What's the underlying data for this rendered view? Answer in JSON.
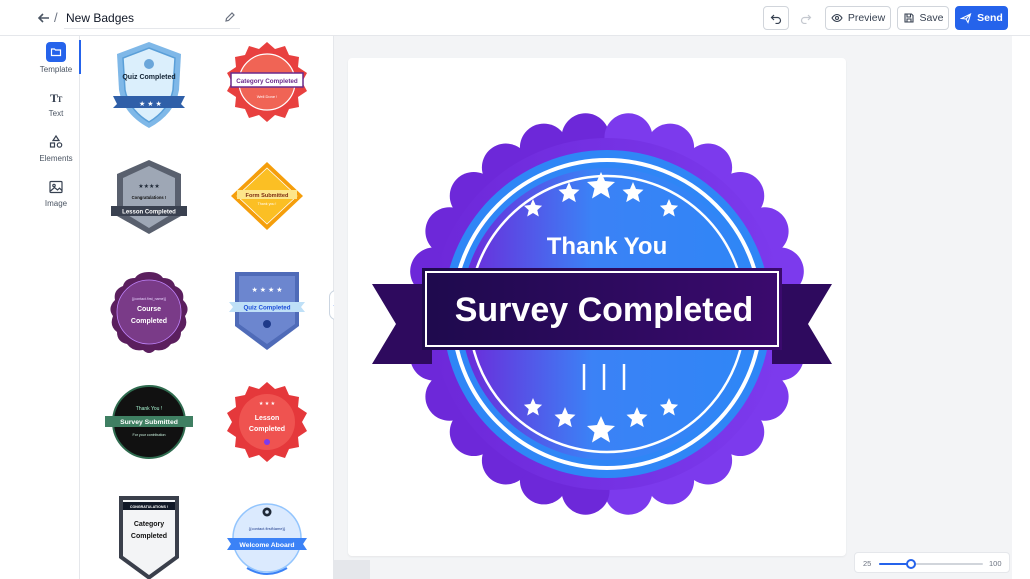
{
  "header": {
    "title": "New Badges",
    "preview_label": "Preview",
    "save_label": "Save",
    "send_label": "Send"
  },
  "rail": {
    "items": [
      {
        "label": "Template",
        "icon": "folder-icon",
        "active": true
      },
      {
        "label": "Text",
        "icon": "text-icon",
        "active": false
      },
      {
        "label": "Elements",
        "icon": "shapes-icon",
        "active": false
      },
      {
        "label": "Image",
        "icon": "image-icon",
        "active": false
      }
    ]
  },
  "templates": [
    {
      "name": "Quiz Completed",
      "style": "shield-blue"
    },
    {
      "name": "Category Completed",
      "sub": "Well Done !",
      "style": "seal-red"
    },
    {
      "name": "Lesson Completed",
      "sub": "Congratulations !",
      "style": "hex-grey"
    },
    {
      "name": "Form Submitted",
      "sub": "Thank you !",
      "style": "diamond-orange"
    },
    {
      "name": "Course Completed",
      "sub": "{{contact.first_name}}",
      "style": "wavy-purple"
    },
    {
      "name": "Quiz Completed",
      "style": "shield-indigo"
    },
    {
      "name": "Survey Submitted",
      "sub": "Thank You !",
      "sub2": "For your contribution",
      "style": "circle-green"
    },
    {
      "name": "Lesson Completed",
      "style": "seal-red2"
    },
    {
      "name": "Category Completed",
      "sub": "CONGRATULATIONS !",
      "style": "shield-dark"
    },
    {
      "name": "Welcome Aboard",
      "sub": "{{contact.firstName}}",
      "style": "circle-blue"
    }
  ],
  "badge": {
    "top_text": "Thank You",
    "main_text": "Survey Completed"
  },
  "zoom": {
    "min": "25",
    "max": "100",
    "value": 48
  },
  "colors": {
    "accent": "#2563eb",
    "badge_purple": "#7c3aed",
    "badge_blue": "#2f86f6",
    "ribbon": "#2e0a5e"
  }
}
